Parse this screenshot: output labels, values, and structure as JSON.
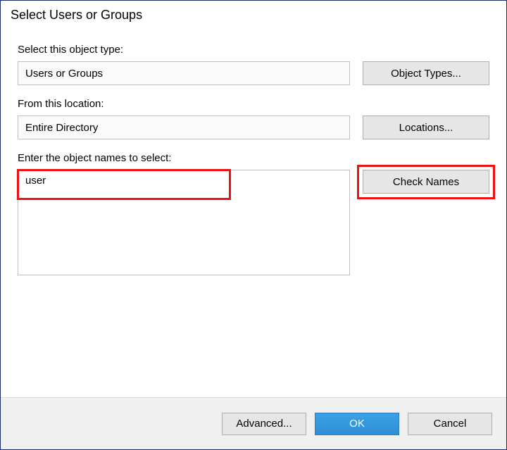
{
  "title": "Select Users or Groups",
  "labels": {
    "object_type": "Select this object type:",
    "location": "From this location:",
    "object_names": "Enter the object names to select:"
  },
  "fields": {
    "object_type_value": "Users or Groups",
    "location_value": "Entire Directory",
    "object_names_value": "user"
  },
  "buttons": {
    "object_types": "Object Types...",
    "locations": "Locations...",
    "check_names": "Check Names",
    "advanced": "Advanced...",
    "ok": "OK",
    "cancel": "Cancel"
  },
  "highlight_color": "#e11"
}
